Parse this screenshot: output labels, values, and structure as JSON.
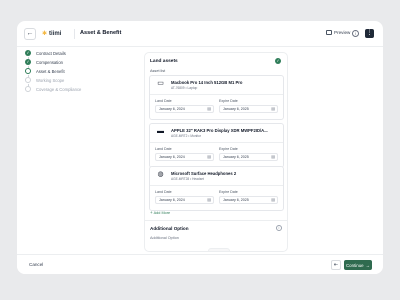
{
  "app": {
    "logo_mark": "✱",
    "logo_text": "tiimi",
    "page_title": "Asset & Benefit",
    "back_icon": "arrow-left-icon",
    "preview_label": "Preview",
    "info_glyph": "i",
    "menu_glyph": "⋮"
  },
  "steps": [
    {
      "label": "Contract Details",
      "state": "done"
    },
    {
      "label": "Compensation",
      "state": "done"
    },
    {
      "label": "Asset & Benefit",
      "state": "current"
    },
    {
      "label": "Working Scope",
      "state": "pending"
    },
    {
      "label": "Coverage & Compliance",
      "state": "pending"
    }
  ],
  "step_check": "✓",
  "land_assets": {
    "title": "Land assets",
    "asset_list_label": "Asset list",
    "land_date_label": "Land Date",
    "expire_date_label": "Expire Date",
    "assets": [
      {
        "icon": "laptop-icon",
        "glyph": "▭",
        "name": "Macbook Pro 14 Inch 512GB M1 Pro",
        "id": "AT-76809",
        "type": "Laptop",
        "land_date": "January 6, 2024",
        "expire_date": "January 6, 2025"
      },
      {
        "icon": "monitor-icon",
        "glyph": "▬",
        "name": "APPLE 32\" RAK3 Pro Display XDR MWPF2ID/A...",
        "id": "AGE-MRT2",
        "type": "Monitor",
        "land_date": "January 6, 2024",
        "expire_date": "January 6, 2025"
      },
      {
        "icon": "headphones-icon",
        "glyph": "◍",
        "name": "Microsoft Surface Headphones 2",
        "id": "AGE-MRT28",
        "type": "Headset",
        "land_date": "January 6, 2024",
        "expire_date": "January 6, 2025"
      }
    ],
    "add_more": "Add More"
  },
  "additional_option": {
    "title": "Additional Option",
    "subtitle": "Additional Option"
  },
  "footer": {
    "cancel": "Cancel",
    "prev_glyph": "⇤",
    "continue": "Continue",
    "continue_glyph": "→"
  },
  "colors": {
    "accent": "#2f7d59",
    "button": "#2f6b4f",
    "logo": "#f4b740"
  }
}
